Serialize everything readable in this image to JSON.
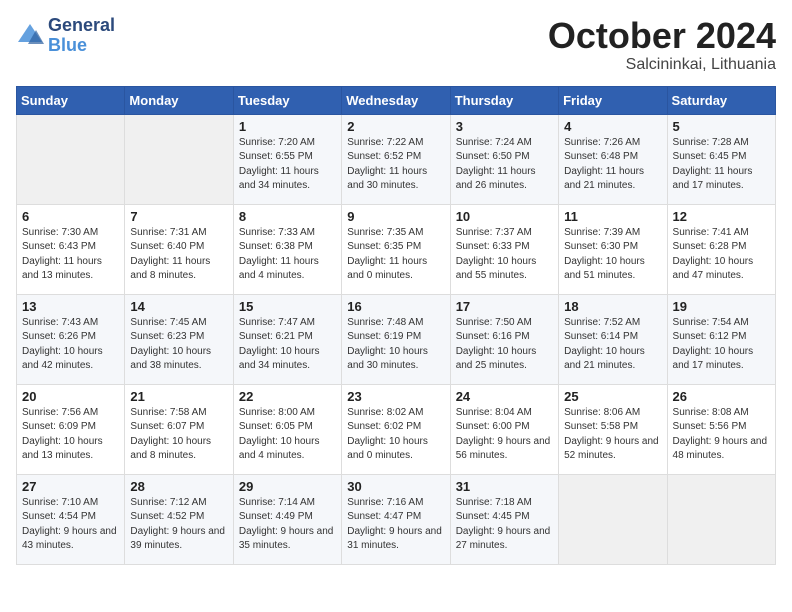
{
  "header": {
    "logo_line1": "General",
    "logo_line2": "Blue",
    "title": "October 2024",
    "subtitle": "Salcininkai, Lithuania"
  },
  "weekdays": [
    "Sunday",
    "Monday",
    "Tuesday",
    "Wednesday",
    "Thursday",
    "Friday",
    "Saturday"
  ],
  "weeks": [
    [
      {
        "day": "",
        "sunrise": "",
        "sunset": "",
        "daylight": ""
      },
      {
        "day": "",
        "sunrise": "",
        "sunset": "",
        "daylight": ""
      },
      {
        "day": "1",
        "sunrise": "Sunrise: 7:20 AM",
        "sunset": "Sunset: 6:55 PM",
        "daylight": "Daylight: 11 hours and 34 minutes."
      },
      {
        "day": "2",
        "sunrise": "Sunrise: 7:22 AM",
        "sunset": "Sunset: 6:52 PM",
        "daylight": "Daylight: 11 hours and 30 minutes."
      },
      {
        "day": "3",
        "sunrise": "Sunrise: 7:24 AM",
        "sunset": "Sunset: 6:50 PM",
        "daylight": "Daylight: 11 hours and 26 minutes."
      },
      {
        "day": "4",
        "sunrise": "Sunrise: 7:26 AM",
        "sunset": "Sunset: 6:48 PM",
        "daylight": "Daylight: 11 hours and 21 minutes."
      },
      {
        "day": "5",
        "sunrise": "Sunrise: 7:28 AM",
        "sunset": "Sunset: 6:45 PM",
        "daylight": "Daylight: 11 hours and 17 minutes."
      }
    ],
    [
      {
        "day": "6",
        "sunrise": "Sunrise: 7:30 AM",
        "sunset": "Sunset: 6:43 PM",
        "daylight": "Daylight: 11 hours and 13 minutes."
      },
      {
        "day": "7",
        "sunrise": "Sunrise: 7:31 AM",
        "sunset": "Sunset: 6:40 PM",
        "daylight": "Daylight: 11 hours and 8 minutes."
      },
      {
        "day": "8",
        "sunrise": "Sunrise: 7:33 AM",
        "sunset": "Sunset: 6:38 PM",
        "daylight": "Daylight: 11 hours and 4 minutes."
      },
      {
        "day": "9",
        "sunrise": "Sunrise: 7:35 AM",
        "sunset": "Sunset: 6:35 PM",
        "daylight": "Daylight: 11 hours and 0 minutes."
      },
      {
        "day": "10",
        "sunrise": "Sunrise: 7:37 AM",
        "sunset": "Sunset: 6:33 PM",
        "daylight": "Daylight: 10 hours and 55 minutes."
      },
      {
        "day": "11",
        "sunrise": "Sunrise: 7:39 AM",
        "sunset": "Sunset: 6:30 PM",
        "daylight": "Daylight: 10 hours and 51 minutes."
      },
      {
        "day": "12",
        "sunrise": "Sunrise: 7:41 AM",
        "sunset": "Sunset: 6:28 PM",
        "daylight": "Daylight: 10 hours and 47 minutes."
      }
    ],
    [
      {
        "day": "13",
        "sunrise": "Sunrise: 7:43 AM",
        "sunset": "Sunset: 6:26 PM",
        "daylight": "Daylight: 10 hours and 42 minutes."
      },
      {
        "day": "14",
        "sunrise": "Sunrise: 7:45 AM",
        "sunset": "Sunset: 6:23 PM",
        "daylight": "Daylight: 10 hours and 38 minutes."
      },
      {
        "day": "15",
        "sunrise": "Sunrise: 7:47 AM",
        "sunset": "Sunset: 6:21 PM",
        "daylight": "Daylight: 10 hours and 34 minutes."
      },
      {
        "day": "16",
        "sunrise": "Sunrise: 7:48 AM",
        "sunset": "Sunset: 6:19 PM",
        "daylight": "Daylight: 10 hours and 30 minutes."
      },
      {
        "day": "17",
        "sunrise": "Sunrise: 7:50 AM",
        "sunset": "Sunset: 6:16 PM",
        "daylight": "Daylight: 10 hours and 25 minutes."
      },
      {
        "day": "18",
        "sunrise": "Sunrise: 7:52 AM",
        "sunset": "Sunset: 6:14 PM",
        "daylight": "Daylight: 10 hours and 21 minutes."
      },
      {
        "day": "19",
        "sunrise": "Sunrise: 7:54 AM",
        "sunset": "Sunset: 6:12 PM",
        "daylight": "Daylight: 10 hours and 17 minutes."
      }
    ],
    [
      {
        "day": "20",
        "sunrise": "Sunrise: 7:56 AM",
        "sunset": "Sunset: 6:09 PM",
        "daylight": "Daylight: 10 hours and 13 minutes."
      },
      {
        "day": "21",
        "sunrise": "Sunrise: 7:58 AM",
        "sunset": "Sunset: 6:07 PM",
        "daylight": "Daylight: 10 hours and 8 minutes."
      },
      {
        "day": "22",
        "sunrise": "Sunrise: 8:00 AM",
        "sunset": "Sunset: 6:05 PM",
        "daylight": "Daylight: 10 hours and 4 minutes."
      },
      {
        "day": "23",
        "sunrise": "Sunrise: 8:02 AM",
        "sunset": "Sunset: 6:02 PM",
        "daylight": "Daylight: 10 hours and 0 minutes."
      },
      {
        "day": "24",
        "sunrise": "Sunrise: 8:04 AM",
        "sunset": "Sunset: 6:00 PM",
        "daylight": "Daylight: 9 hours and 56 minutes."
      },
      {
        "day": "25",
        "sunrise": "Sunrise: 8:06 AM",
        "sunset": "Sunset: 5:58 PM",
        "daylight": "Daylight: 9 hours and 52 minutes."
      },
      {
        "day": "26",
        "sunrise": "Sunrise: 8:08 AM",
        "sunset": "Sunset: 5:56 PM",
        "daylight": "Daylight: 9 hours and 48 minutes."
      }
    ],
    [
      {
        "day": "27",
        "sunrise": "Sunrise: 7:10 AM",
        "sunset": "Sunset: 4:54 PM",
        "daylight": "Daylight: 9 hours and 43 minutes."
      },
      {
        "day": "28",
        "sunrise": "Sunrise: 7:12 AM",
        "sunset": "Sunset: 4:52 PM",
        "daylight": "Daylight: 9 hours and 39 minutes."
      },
      {
        "day": "29",
        "sunrise": "Sunrise: 7:14 AM",
        "sunset": "Sunset: 4:49 PM",
        "daylight": "Daylight: 9 hours and 35 minutes."
      },
      {
        "day": "30",
        "sunrise": "Sunrise: 7:16 AM",
        "sunset": "Sunset: 4:47 PM",
        "daylight": "Daylight: 9 hours and 31 minutes."
      },
      {
        "day": "31",
        "sunrise": "Sunrise: 7:18 AM",
        "sunset": "Sunset: 4:45 PM",
        "daylight": "Daylight: 9 hours and 27 minutes."
      },
      {
        "day": "",
        "sunrise": "",
        "sunset": "",
        "daylight": ""
      },
      {
        "day": "",
        "sunrise": "",
        "sunset": "",
        "daylight": ""
      }
    ]
  ]
}
